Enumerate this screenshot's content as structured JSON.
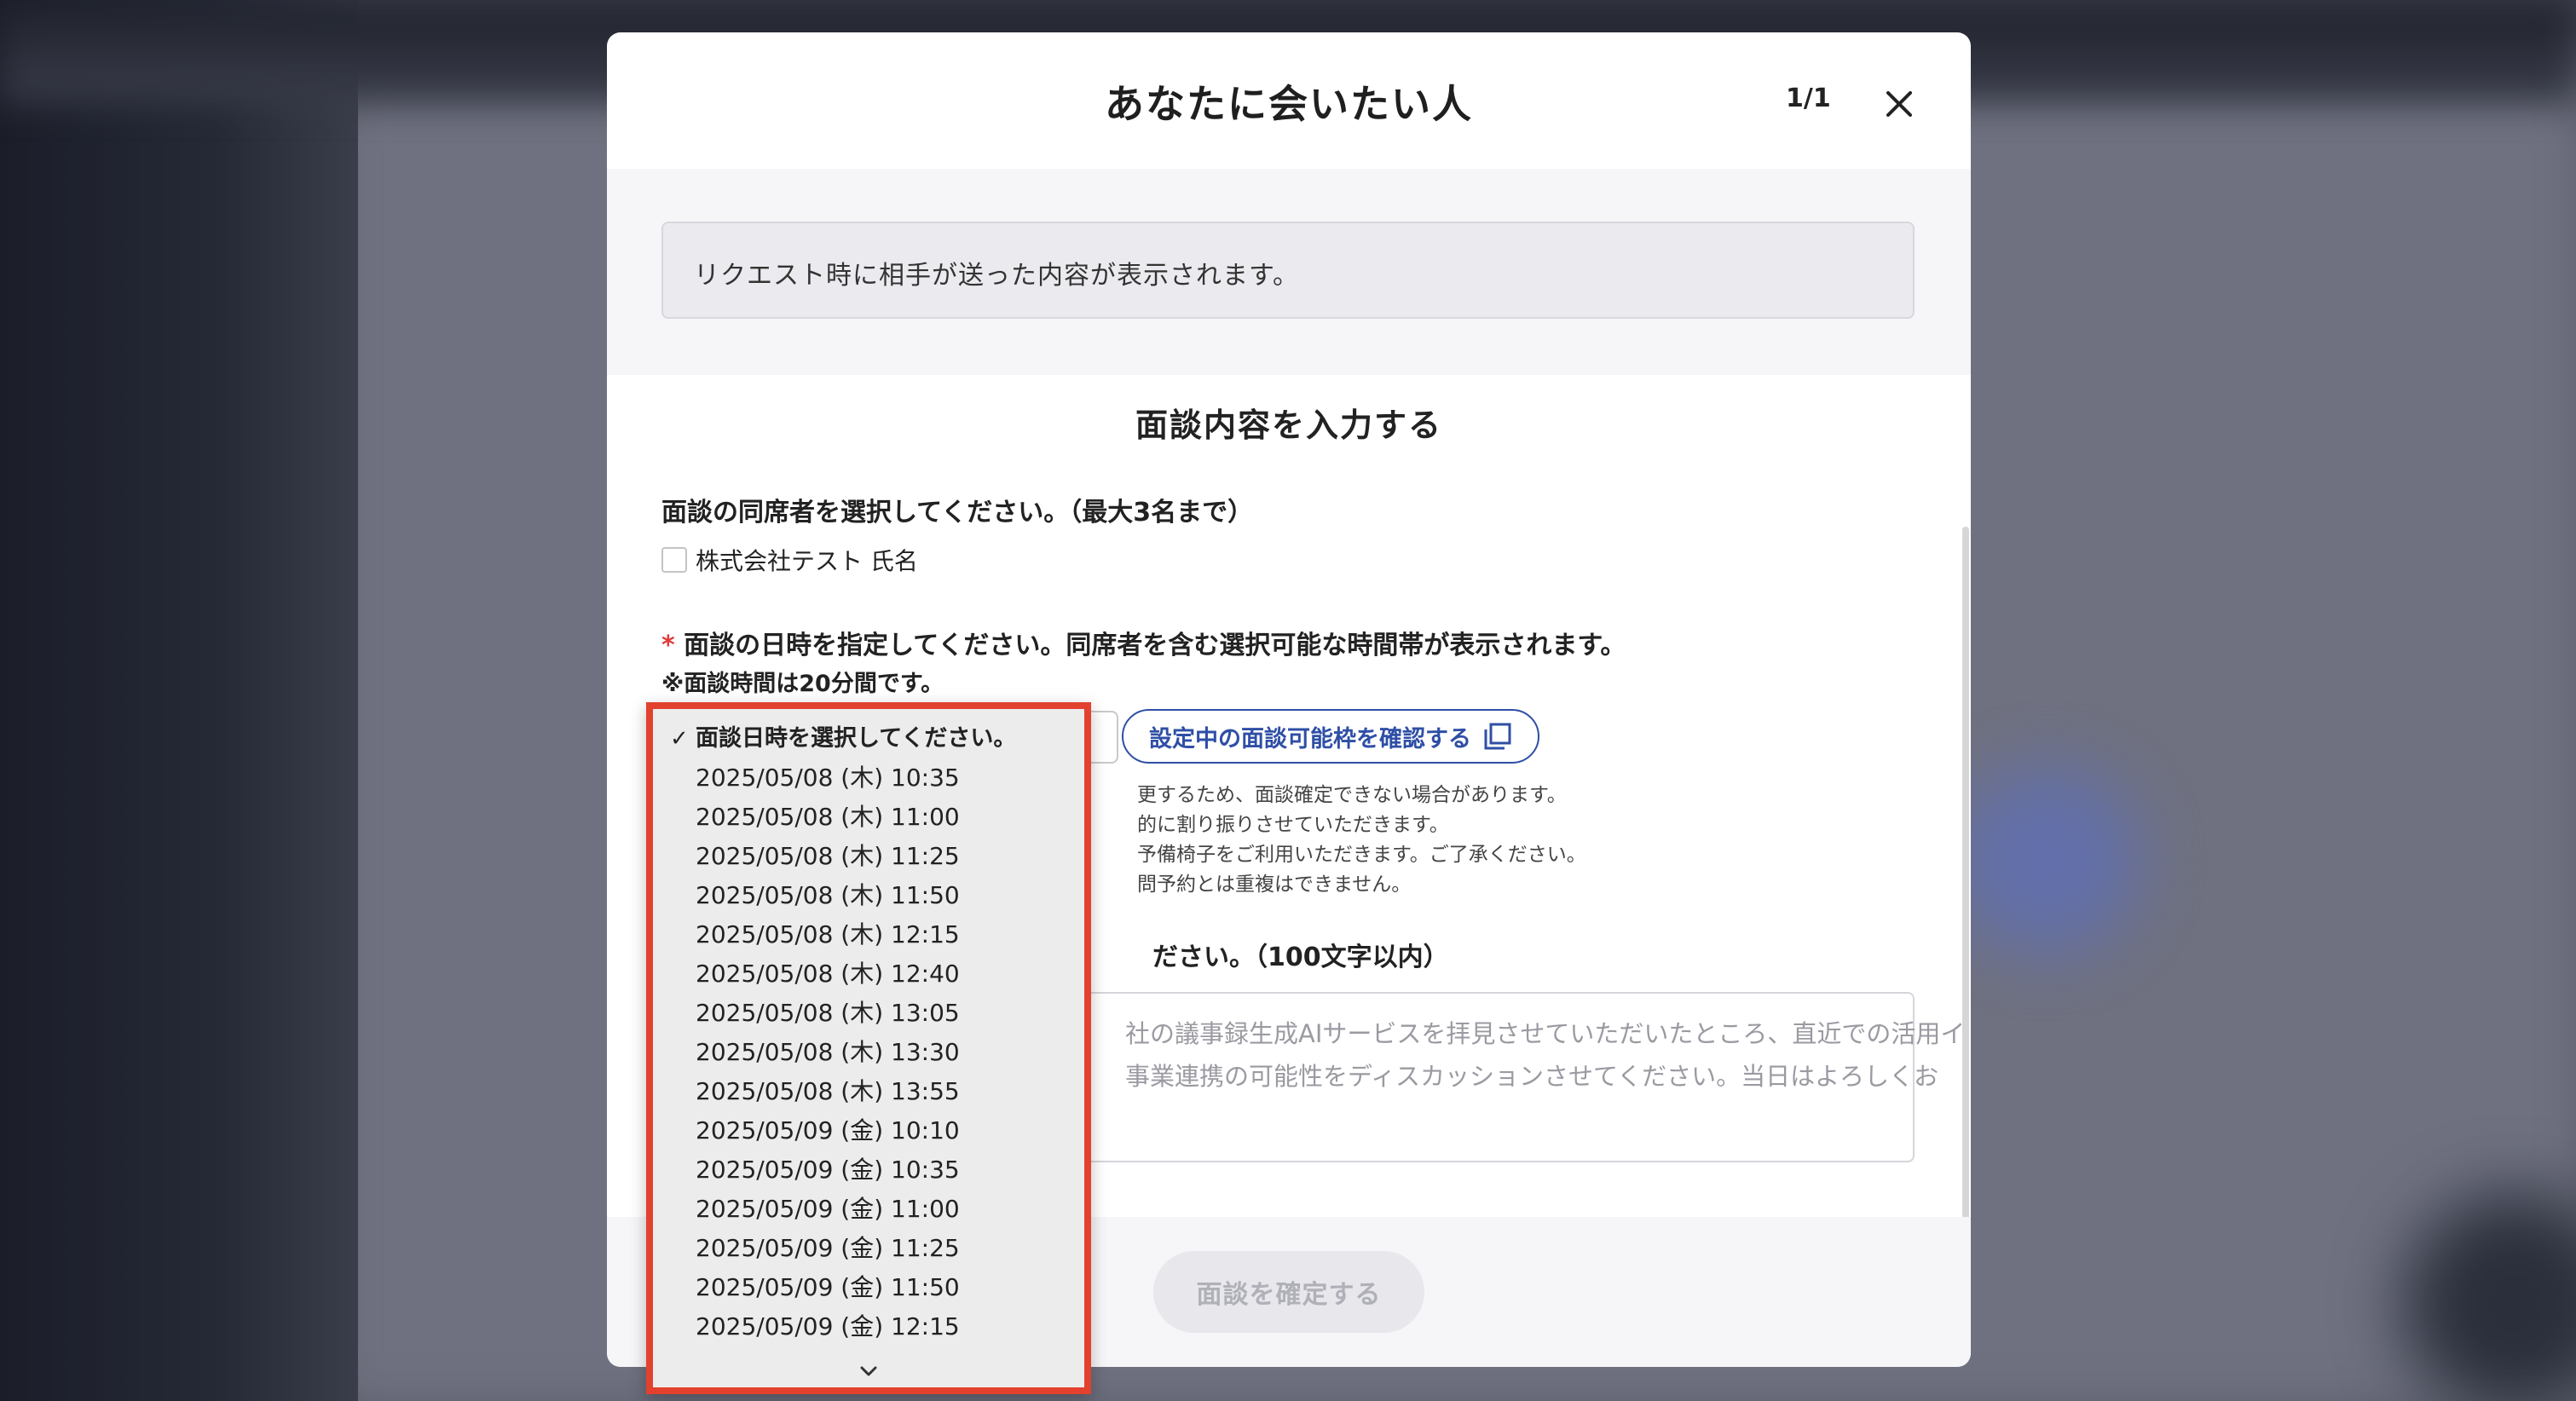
{
  "modal": {
    "title": "あなたに会いたい人",
    "page_counter": "1/1",
    "request_note": "リクエスト時に相手が送った内容が表示されます。",
    "section_title": "面談内容を入力する",
    "attendee_label": "面談の同席者を選択してください。（最大3名まで）",
    "attendee_option": "株式会社テスト 氏名",
    "required_mark": "*",
    "date_label": "面談の日時を指定してください。同席者を含む選択可能な時間帯が表示されます。",
    "date_note": "※面談時間は20分間です。",
    "confirm_slots_label": "設定中の面談可能枠を確認する",
    "notice_lines": [
      "更するため、面談確定できない場合があります。",
      "的に割り振りさせていただきます。",
      "予備椅子をご利用いただきます。ご了承ください。",
      "問予約とは重複はできません。"
    ],
    "message_label": "ださい。（100文字以内）",
    "message_placeholder_lines": [
      "社の議事録生成AIサービスを拝見させていただいたところ、直近での活用イ",
      "事業連携の可能性をディスカッションさせてください。当日はよろしくお"
    ],
    "submit_label": "面談を確定する"
  },
  "dropdown": {
    "placeholder": "面談日時を選択してください。",
    "checkmark": "✓",
    "options": [
      "2025/05/08 (木) 10:35",
      "2025/05/08 (木) 11:00",
      "2025/05/08 (木) 11:25",
      "2025/05/08 (木) 11:50",
      "2025/05/08 (木) 12:15",
      "2025/05/08 (木) 12:40",
      "2025/05/08 (木) 13:05",
      "2025/05/08 (木) 13:30",
      "2025/05/08 (木) 13:55",
      "2025/05/09 (金) 10:10",
      "2025/05/09 (金) 10:35",
      "2025/05/09 (金) 11:00",
      "2025/05/09 (金) 11:25",
      "2025/05/09 (金) 11:50",
      "2025/05/09 (金) 12:15"
    ]
  },
  "icons": {
    "close": "close-icon",
    "window": "window-icon",
    "more": "chevron-down-icon"
  },
  "colors": {
    "accent": "#2f4fa6",
    "highlight_border": "#e2412e",
    "required": "#e23a3a"
  }
}
